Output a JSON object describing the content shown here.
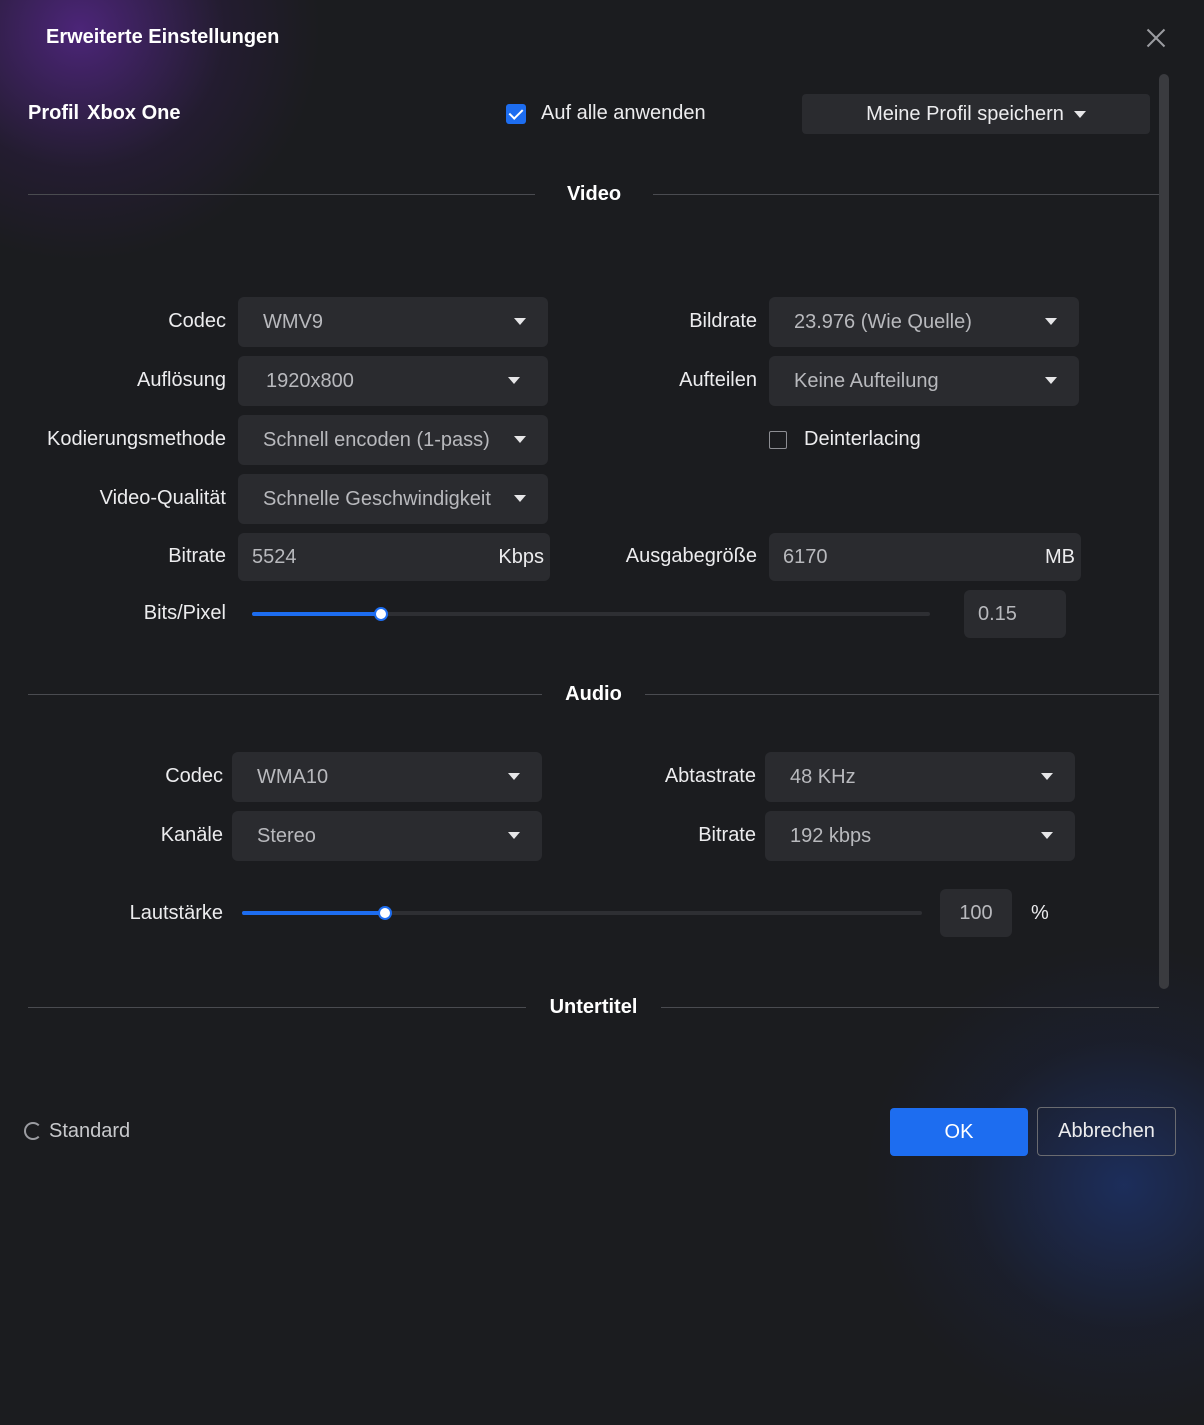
{
  "dialog": {
    "title": "Erweiterte Einstellungen"
  },
  "profile": {
    "label": "Profil",
    "name": "Xbox One"
  },
  "apply_all": {
    "label": "Auf alle anwenden",
    "checked": true
  },
  "save_profile": {
    "label": "Meine Profil speichern"
  },
  "video": {
    "section_title": "Video",
    "codec": {
      "label": "Codec",
      "value": "WMV9"
    },
    "framerate": {
      "label": "Bildrate",
      "value": "23.976 (Wie Quelle)"
    },
    "resolution": {
      "label": "Auflösung",
      "value": "1920x800"
    },
    "split": {
      "label": "Aufteilen",
      "value": "Keine Aufteilung"
    },
    "encoding_method": {
      "label": "Kodierungsmethode",
      "value": "Schnell encoden (1-pass)"
    },
    "deinterlacing": {
      "label": "Deinterlacing",
      "checked": false
    },
    "quality": {
      "label": "Video-Qualität",
      "value": "Schnelle Geschwindigkeit"
    },
    "bitrate": {
      "label": "Bitrate",
      "value": "5524",
      "unit": "Kbps"
    },
    "output_size": {
      "label": "Ausgabegröße",
      "value": "6170",
      "unit": "MB"
    },
    "bits_per_pixel": {
      "label": "Bits/Pixel",
      "value": "0.15",
      "slider_fraction": 0.19
    }
  },
  "audio": {
    "section_title": "Audio",
    "codec": {
      "label": "Codec",
      "value": "WMA10"
    },
    "sample_rate": {
      "label": "Abtastrate",
      "value": "48 KHz"
    },
    "channels": {
      "label": "Kanäle",
      "value": "Stereo"
    },
    "bitrate": {
      "label": "Bitrate",
      "value": "192 kbps"
    },
    "volume": {
      "label": "Lautstärke",
      "value": "100",
      "unit": "%",
      "slider_fraction": 0.21
    }
  },
  "subtitles": {
    "section_title": "Untertitel"
  },
  "footer": {
    "standard_label": "Standard",
    "ok_label": "OK",
    "cancel_label": "Abbrechen"
  },
  "colors": {
    "accent": "#1d6df0",
    "background": "#1b1c1f",
    "control": "#2a2b2f"
  },
  "icons": [
    "close-icon",
    "check-icon",
    "chevron-down-icon",
    "reset-icon"
  ]
}
